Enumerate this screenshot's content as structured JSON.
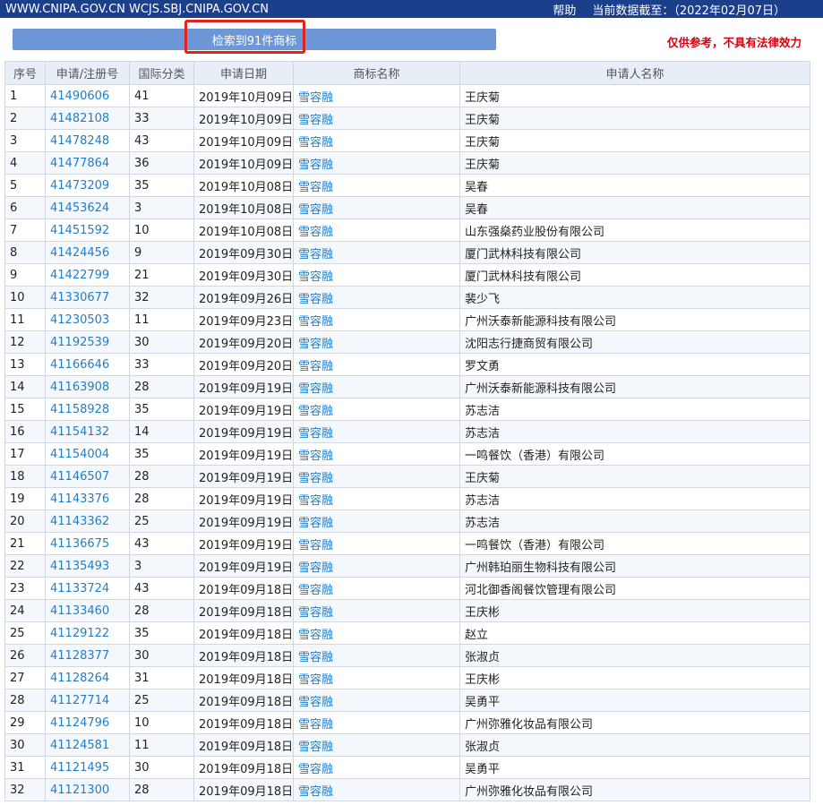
{
  "header": {
    "site": "WWW.CNIPA.GOV.CN WCJS.SBJ.CNIPA.GOV.CN",
    "help": "帮助",
    "data_date": "当前数据截至：（2022年02月07日）"
  },
  "toolbar": {
    "count": "检索到91件商标",
    "disclaimer": "仅供参考，不具有法律效力"
  },
  "columns": [
    "序号",
    "申请/注册号",
    "国际分类",
    "申请日期",
    "商标名称",
    "申请人名称"
  ],
  "rows": [
    {
      "no": "1",
      "reg": "41490606",
      "cls": "41",
      "date": "2019年10月09日",
      "name": "雪容融",
      "applicant": "王庆菊"
    },
    {
      "no": "2",
      "reg": "41482108",
      "cls": "33",
      "date": "2019年10月09日",
      "name": "雪容融",
      "applicant": "王庆菊"
    },
    {
      "no": "3",
      "reg": "41478248",
      "cls": "43",
      "date": "2019年10月09日",
      "name": "雪容融",
      "applicant": "王庆菊"
    },
    {
      "no": "4",
      "reg": "41477864",
      "cls": "36",
      "date": "2019年10月09日",
      "name": "雪容融",
      "applicant": "王庆菊"
    },
    {
      "no": "5",
      "reg": "41473209",
      "cls": "35",
      "date": "2019年10月08日",
      "name": "雪容融",
      "applicant": "吴春"
    },
    {
      "no": "6",
      "reg": "41453624",
      "cls": "3",
      "date": "2019年10月08日",
      "name": "雪容融",
      "applicant": "吴春"
    },
    {
      "no": "7",
      "reg": "41451592",
      "cls": "10",
      "date": "2019年10月08日",
      "name": "雪容融",
      "applicant": "山东强燊药业股份有限公司"
    },
    {
      "no": "8",
      "reg": "41424456",
      "cls": "9",
      "date": "2019年09月30日",
      "name": "雪容融",
      "applicant": "厦门武林科技有限公司"
    },
    {
      "no": "9",
      "reg": "41422799",
      "cls": "21",
      "date": "2019年09月30日",
      "name": "雪容融",
      "applicant": "厦门武林科技有限公司"
    },
    {
      "no": "10",
      "reg": "41330677",
      "cls": "32",
      "date": "2019年09月26日",
      "name": "雪容融",
      "applicant": "裴少飞"
    },
    {
      "no": "11",
      "reg": "41230503",
      "cls": "11",
      "date": "2019年09月23日",
      "name": "雪容融",
      "applicant": "广州沃泰新能源科技有限公司"
    },
    {
      "no": "12",
      "reg": "41192539",
      "cls": "30",
      "date": "2019年09月20日",
      "name": "雪容融",
      "applicant": "沈阳志行捷商贸有限公司"
    },
    {
      "no": "13",
      "reg": "41166646",
      "cls": "33",
      "date": "2019年09月20日",
      "name": "雪容融",
      "applicant": "罗文勇"
    },
    {
      "no": "14",
      "reg": "41163908",
      "cls": "28",
      "date": "2019年09月19日",
      "name": "雪容融",
      "applicant": "广州沃泰新能源科技有限公司"
    },
    {
      "no": "15",
      "reg": "41158928",
      "cls": "35",
      "date": "2019年09月19日",
      "name": "雪容融",
      "applicant": "苏志洁"
    },
    {
      "no": "16",
      "reg": "41154132",
      "cls": "14",
      "date": "2019年09月19日",
      "name": "雪容融",
      "applicant": "苏志洁"
    },
    {
      "no": "17",
      "reg": "41154004",
      "cls": "35",
      "date": "2019年09月19日",
      "name": "雪容融",
      "applicant": "一鸣餐饮（香港）有限公司"
    },
    {
      "no": "18",
      "reg": "41146507",
      "cls": "28",
      "date": "2019年09月19日",
      "name": "雪容融",
      "applicant": "王庆菊"
    },
    {
      "no": "19",
      "reg": "41143376",
      "cls": "28",
      "date": "2019年09月19日",
      "name": "雪容融",
      "applicant": "苏志洁"
    },
    {
      "no": "20",
      "reg": "41143362",
      "cls": "25",
      "date": "2019年09月19日",
      "name": "雪容融",
      "applicant": "苏志洁"
    },
    {
      "no": "21",
      "reg": "41136675",
      "cls": "43",
      "date": "2019年09月19日",
      "name": "雪容融",
      "applicant": "一鸣餐饮（香港）有限公司"
    },
    {
      "no": "22",
      "reg": "41135493",
      "cls": "3",
      "date": "2019年09月19日",
      "name": "雪容融",
      "applicant": "广州韩珀丽生物科技有限公司"
    },
    {
      "no": "23",
      "reg": "41133724",
      "cls": "43",
      "date": "2019年09月18日",
      "name": "雪容融",
      "applicant": "河北御香阁餐饮管理有限公司"
    },
    {
      "no": "24",
      "reg": "41133460",
      "cls": "28",
      "date": "2019年09月18日",
      "name": "雪容融",
      "applicant": "王庆彬"
    },
    {
      "no": "25",
      "reg": "41129122",
      "cls": "35",
      "date": "2019年09月18日",
      "name": "雪容融",
      "applicant": "赵立"
    },
    {
      "no": "26",
      "reg": "41128377",
      "cls": "30",
      "date": "2019年09月18日",
      "name": "雪容融",
      "applicant": "张淑贞"
    },
    {
      "no": "27",
      "reg": "41128264",
      "cls": "31",
      "date": "2019年09月18日",
      "name": "雪容融",
      "applicant": "王庆彬"
    },
    {
      "no": "28",
      "reg": "41127714",
      "cls": "25",
      "date": "2019年09月18日",
      "name": "雪容融",
      "applicant": "吴勇平"
    },
    {
      "no": "29",
      "reg": "41124796",
      "cls": "10",
      "date": "2019年09月18日",
      "name": "雪容融",
      "applicant": "广州弥雅化妆品有限公司"
    },
    {
      "no": "30",
      "reg": "41124581",
      "cls": "11",
      "date": "2019年09月18日",
      "name": "雪容融",
      "applicant": "张淑贞"
    },
    {
      "no": "31",
      "reg": "41121495",
      "cls": "30",
      "date": "2019年09月18日",
      "name": "雪容融",
      "applicant": "吴勇平"
    },
    {
      "no": "32",
      "reg": "41121300",
      "cls": "28",
      "date": "2019年09月18日",
      "name": "雪容融",
      "applicant": "广州弥雅化妆品有限公司"
    }
  ]
}
